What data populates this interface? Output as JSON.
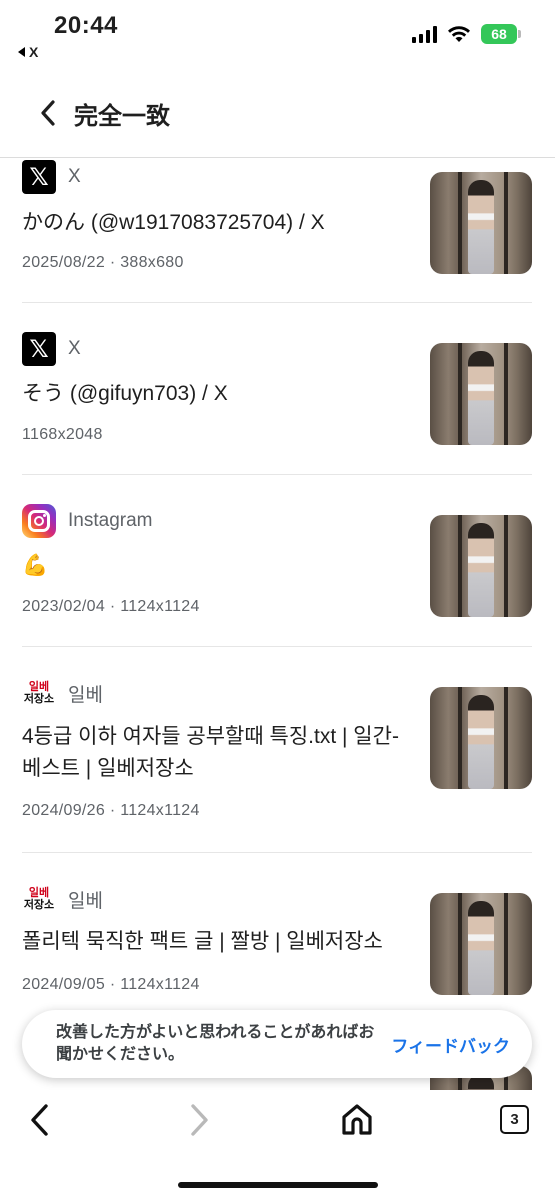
{
  "status_bar": {
    "time": "20:44",
    "back_app": "X",
    "battery": "68"
  },
  "header": {
    "title": "完全一致"
  },
  "results": [
    {
      "source": "X",
      "icon": "x-logo-icon",
      "title": "かのん (@w1917083725704) / X",
      "meta": "2025/08/22 · 388x680"
    },
    {
      "source": "X",
      "icon": "x-logo-icon",
      "title": "そう (@gifuyn703) / X",
      "meta": "1168x2048"
    },
    {
      "source": "Instagram",
      "icon": "instagram-logo-icon",
      "title": "💪",
      "meta": "2023/02/04 · 1124x1124"
    },
    {
      "source": "일베",
      "icon": "ilbe-logo-icon",
      "title": "4등급 이하 여자들 공부할때 특징.txt | 일간-베스트 | 일베저장소",
      "meta": "2024/09/26 · 1124x1124"
    },
    {
      "source": "일베",
      "icon": "ilbe-logo-icon",
      "title": "폴리텍 묵직한 팩트 글 | 짤방 | 일베저장소",
      "meta": "2024/09/05 · 1124x1124"
    }
  ],
  "ilbe_logo_text": {
    "line1": "일베",
    "line2": "저장소"
  },
  "feedback": {
    "text": "改善した方がよいと思われることがあればお聞かせください。",
    "link": "フィードバック"
  },
  "bottom_nav": {
    "tab_count": "3"
  },
  "colors": {
    "link_blue": "#1a73e8",
    "battery_green": "#34c759",
    "meta_gray": "#5f6368"
  }
}
